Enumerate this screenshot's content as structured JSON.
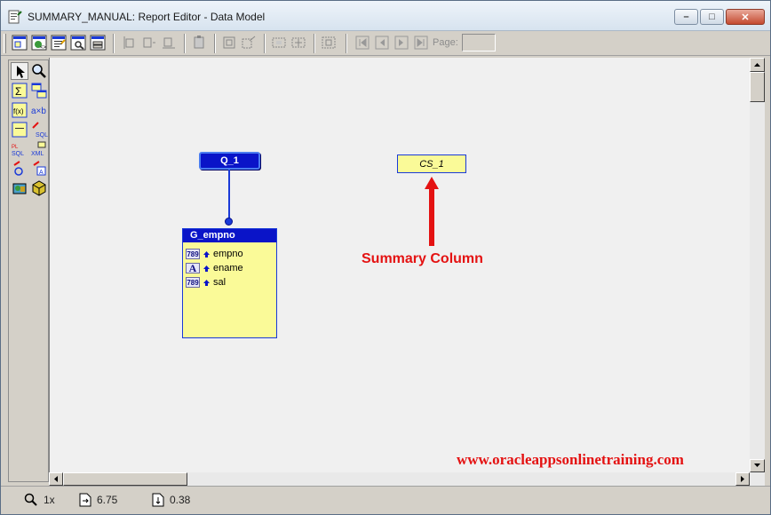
{
  "window": {
    "title": "SUMMARY_MANUAL: Report Editor - Data Model",
    "controls": {
      "minimize": "–",
      "maximize": "□",
      "close": "✕"
    }
  },
  "toolbar": {
    "buttons": [
      "data-model-icon",
      "web-source-icon",
      "paper-layout-icon",
      "paper-design-icon",
      "parameter-form-icon",
      "align-left-icon",
      "align-center-icon",
      "align-bottom-icon",
      "stack-icon",
      "group-icon",
      "expand-icon",
      "frame-icon",
      "move-icon",
      "select-icon",
      "first-page-icon",
      "previous-page-icon",
      "next-page-icon",
      "last-page-icon"
    ],
    "page_label": "Page:",
    "page_value": ""
  },
  "palette": {
    "tools": [
      "select-arrow-icon",
      "magnify-icon",
      "summary-column-icon",
      "data-link-icon",
      "formula-column-icon",
      "placeholder-column-icon",
      "cross-product-icon",
      "sql-query-icon",
      "plsql-query-icon",
      "xml-query-icon",
      "ref-cursor-icon",
      "text-query-icon",
      "database-icon",
      "object-icon"
    ],
    "labels": {
      "sigma": "Σ",
      "formula": "f(x)",
      "axb": "a×b",
      "sql": "SQL",
      "plsql": "PL SQL",
      "xml": "XML"
    }
  },
  "model": {
    "query": {
      "name": "Q_1"
    },
    "group": {
      "name": "G_empno",
      "columns": [
        {
          "name": "empno",
          "type": "789"
        },
        {
          "name": "ename",
          "type": "A"
        },
        {
          "name": "sal",
          "type": "789"
        }
      ]
    },
    "summary_column": {
      "name": "CS_1"
    }
  },
  "annotation": {
    "label": "Summary Column",
    "color": "#e41212"
  },
  "watermark": "www.oracleappsonlinetraining.com",
  "statusbar": {
    "zoom": "1x",
    "x_position": "6.75",
    "y_position": "0.38"
  },
  "colors": {
    "object_header": "#0a14c8",
    "object_fill": "#fafa98",
    "canvas": "#f0f0f0"
  }
}
